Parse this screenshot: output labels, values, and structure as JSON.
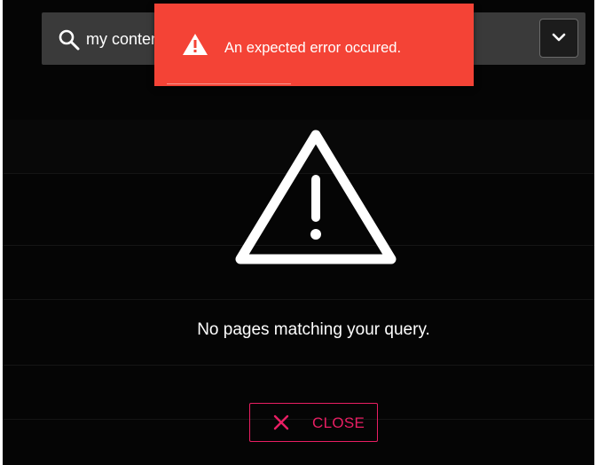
{
  "search": {
    "value": "my content",
    "icon": "search-icon"
  },
  "dropdown": {
    "icon": "chevron-down-icon"
  },
  "toast": {
    "message": "An expected error occured.",
    "icon": "warning-icon",
    "background_color": "#f44336"
  },
  "empty_state": {
    "icon": "warning-icon",
    "message": "No pages matching your query."
  },
  "close_button": {
    "label": "CLOSE",
    "icon": "close-icon",
    "accent_color": "#e91e63"
  }
}
